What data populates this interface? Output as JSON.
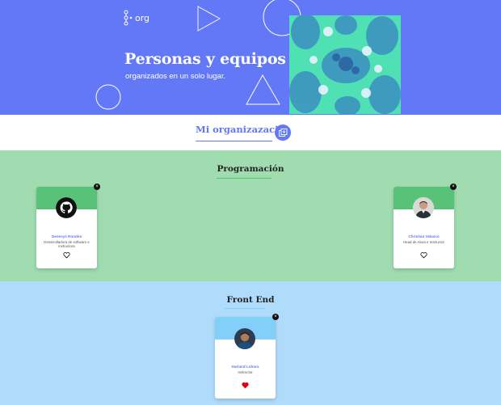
{
  "header": {
    "logo_text": "org",
    "title": "Personas y equipos",
    "subtitle": "organizados en un solo lugar."
  },
  "organization": {
    "title": "Mi organizazación",
    "add_icon": "add-team-icon"
  },
  "teams": [
    {
      "name": "Programación",
      "primary_color": "#57c278",
      "secondary_color": "#a0dcb0",
      "members": [
        {
          "name": "Genesys Rondón",
          "role": "Desarrolladora de software e instructora",
          "avatar": "github-icon",
          "favorite": false
        },
        {
          "name": "Christian Velasco",
          "role": "Head de Alura e Instructor",
          "avatar": "person-photo",
          "favorite": false
        }
      ]
    },
    {
      "name": "Front End",
      "primary_color": "#82cffa",
      "secondary_color": "#b0dcfb",
      "members": [
        {
          "name": "Harland Lohora",
          "role": "Instructor",
          "avatar": "person-photo",
          "favorite": true
        }
      ]
    }
  ],
  "colors": {
    "brand": "#6278f7",
    "favorite": "#e3000f"
  }
}
